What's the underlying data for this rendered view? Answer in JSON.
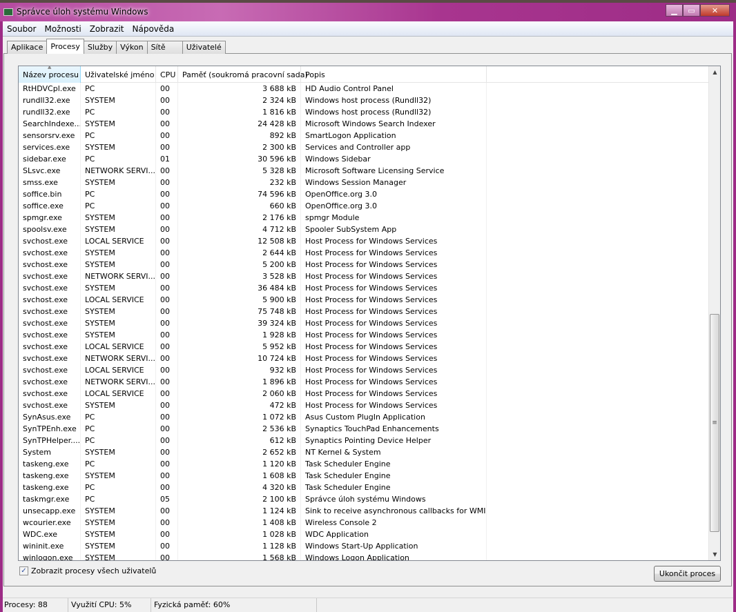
{
  "window": {
    "title": "Správce úloh systému Windows",
    "minimize": "▁",
    "maximize": "▭",
    "close": "✕"
  },
  "menu": [
    "Soubor",
    "Možnosti",
    "Zobrazit",
    "Nápověda"
  ],
  "tabs": [
    {
      "label": "Aplikace"
    },
    {
      "label": "Procesy",
      "active": true
    },
    {
      "label": "Služby"
    },
    {
      "label": "Výkon"
    },
    {
      "label": "Sítě"
    },
    {
      "label": "Uživatelé"
    }
  ],
  "columns": [
    "Název procesu",
    "Uživatelské jméno",
    "CPU",
    "Paměť (soukromá pracovní sada)",
    "Popis"
  ],
  "rows": [
    [
      "RtHDVCpl.exe",
      "PC",
      "00",
      "3 688 kB",
      "HD Audio Control Panel"
    ],
    [
      "rundll32.exe",
      "SYSTEM",
      "00",
      "2 324 kB",
      "Windows host process (Rundll32)"
    ],
    [
      "rundll32.exe",
      "PC",
      "00",
      "1 816 kB",
      "Windows host process (Rundll32)"
    ],
    [
      "SearchIndexe...",
      "SYSTEM",
      "00",
      "24 428 kB",
      "Microsoft Windows Search Indexer"
    ],
    [
      "sensorsrv.exe",
      "PC",
      "00",
      "892 kB",
      "SmartLogon Application"
    ],
    [
      "services.exe",
      "SYSTEM",
      "00",
      "2 300 kB",
      "Services and Controller app"
    ],
    [
      "sidebar.exe",
      "PC",
      "01",
      "30 596 kB",
      "Windows Sidebar"
    ],
    [
      "SLsvc.exe",
      "NETWORK SERVI...",
      "00",
      "5 328 kB",
      "Microsoft Software Licensing Service"
    ],
    [
      "smss.exe",
      "SYSTEM",
      "00",
      "232 kB",
      "Windows Session Manager"
    ],
    [
      "soffice.bin",
      "PC",
      "00",
      "74 596 kB",
      "OpenOffice.org 3.0"
    ],
    [
      "soffice.exe",
      "PC",
      "00",
      "660 kB",
      "OpenOffice.org 3.0"
    ],
    [
      "spmgr.exe",
      "SYSTEM",
      "00",
      "2 176 kB",
      "spmgr Module"
    ],
    [
      "spoolsv.exe",
      "SYSTEM",
      "00",
      "4 712 kB",
      "Spooler SubSystem App"
    ],
    [
      "svchost.exe",
      "LOCAL SERVICE",
      "00",
      "12 508 kB",
      "Host Process for Windows Services"
    ],
    [
      "svchost.exe",
      "SYSTEM",
      "00",
      "2 644 kB",
      "Host Process for Windows Services"
    ],
    [
      "svchost.exe",
      "SYSTEM",
      "00",
      "5 200 kB",
      "Host Process for Windows Services"
    ],
    [
      "svchost.exe",
      "NETWORK SERVI...",
      "00",
      "3 528 kB",
      "Host Process for Windows Services"
    ],
    [
      "svchost.exe",
      "SYSTEM",
      "00",
      "36 484 kB",
      "Host Process for Windows Services"
    ],
    [
      "svchost.exe",
      "LOCAL SERVICE",
      "00",
      "5 900 kB",
      "Host Process for Windows Services"
    ],
    [
      "svchost.exe",
      "SYSTEM",
      "00",
      "75 748 kB",
      "Host Process for Windows Services"
    ],
    [
      "svchost.exe",
      "SYSTEM",
      "00",
      "39 324 kB",
      "Host Process for Windows Services"
    ],
    [
      "svchost.exe",
      "SYSTEM",
      "00",
      "1 928 kB",
      "Host Process for Windows Services"
    ],
    [
      "svchost.exe",
      "LOCAL SERVICE",
      "00",
      "5 952 kB",
      "Host Process for Windows Services"
    ],
    [
      "svchost.exe",
      "NETWORK SERVI...",
      "00",
      "10 724 kB",
      "Host Process for Windows Services"
    ],
    [
      "svchost.exe",
      "LOCAL SERVICE",
      "00",
      "932 kB",
      "Host Process for Windows Services"
    ],
    [
      "svchost.exe",
      "NETWORK SERVI...",
      "00",
      "1 896 kB",
      "Host Process for Windows Services"
    ],
    [
      "svchost.exe",
      "LOCAL SERVICE",
      "00",
      "2 060 kB",
      "Host Process for Windows Services"
    ],
    [
      "svchost.exe",
      "SYSTEM",
      "00",
      "472 kB",
      "Host Process for Windows Services"
    ],
    [
      "SynAsus.exe",
      "PC",
      "00",
      "1 072 kB",
      "Asus Custom PlugIn Application"
    ],
    [
      "SynTPEnh.exe",
      "PC",
      "00",
      "2 536 kB",
      "Synaptics TouchPad Enhancements"
    ],
    [
      "SynTPHelper....",
      "PC",
      "00",
      "612 kB",
      "Synaptics Pointing Device Helper"
    ],
    [
      "System",
      "SYSTEM",
      "00",
      "2 652 kB",
      "NT Kernel & System"
    ],
    [
      "taskeng.exe",
      "PC",
      "00",
      "1 120 kB",
      "Task Scheduler Engine"
    ],
    [
      "taskeng.exe",
      "SYSTEM",
      "00",
      "1 608 kB",
      "Task Scheduler Engine"
    ],
    [
      "taskeng.exe",
      "PC",
      "00",
      "4 320 kB",
      "Task Scheduler Engine"
    ],
    [
      "taskmgr.exe",
      "PC",
      "05",
      "2 100 kB",
      "Správce úloh systému Windows"
    ],
    [
      "unsecapp.exe",
      "SYSTEM",
      "00",
      "1 124 kB",
      "Sink to receive asynchronous callbacks for WMI cli..."
    ],
    [
      "wcourier.exe",
      "SYSTEM",
      "00",
      "1 408 kB",
      "Wireless Console 2"
    ],
    [
      "WDC.exe",
      "SYSTEM",
      "00",
      "1 028 kB",
      "WDC Application"
    ],
    [
      "wininit.exe",
      "SYSTEM",
      "00",
      "1 128 kB",
      "Windows Start-Up Application"
    ],
    [
      "winlogon.exe",
      "SYSTEM",
      "00",
      "1 568 kB",
      "Windows Logon Application"
    ]
  ],
  "show_all_users": {
    "label": "Zobrazit procesy všech uživatelů",
    "checked": true,
    "mark": "✓"
  },
  "end_process_label": "Ukončit proces",
  "status": {
    "processes": "Procesy: 88",
    "cpu": "Využití CPU: 5%",
    "memory": "Fyzická paměť: 60%"
  }
}
